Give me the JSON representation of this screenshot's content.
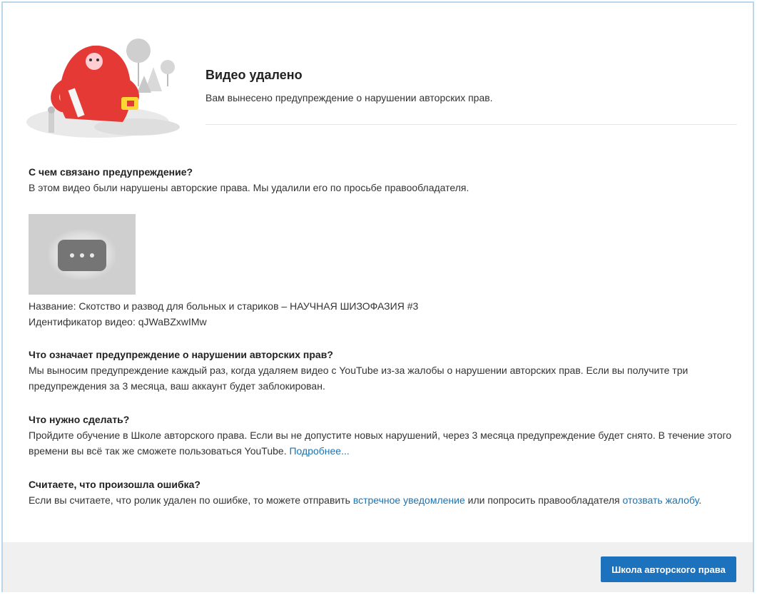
{
  "header": {
    "title": "Видео удалено",
    "subtitle": "Вам вынесено предупреждение о нарушении авторских прав."
  },
  "reason": {
    "title": "С чем связано предупреждение?",
    "text": "В этом видео были нарушены авторские права. Мы удалили его по просьбе правообладателя."
  },
  "video": {
    "title_line": "Название: Скотство и развод для больных и стариков – НАУЧНАЯ ШИЗОФАЗИЯ #3",
    "id_line": "Идентификатор видео: qJWaBZxwIMw"
  },
  "meaning": {
    "title": "Что означает предупреждение о нарушении авторских прав?",
    "text": "Мы выносим предупреждение каждый раз, когда удаляем видео с YouTube из-за жалобы о нарушении авторских прав. Если вы получите три предупреждения за 3 месяца, ваш аккаунт будет заблокирован."
  },
  "todo": {
    "title": "Что нужно сделать?",
    "text": "Пройдите обучение в Школе авторского права. Если вы не допустите новых нарушений, через 3 месяца предупреждение будет снято. В течение этого времени вы всё так же сможете пользоваться YouTube.",
    "link": "Подробнее..."
  },
  "error": {
    "title": "Считаете, что произошла ошибка?",
    "text_before": "Если вы считаете, что ролик удален по ошибке, то можете отправить ",
    "link1": "встречное уведомление",
    "text_middle": " или попросить правообладателя ",
    "link2": "отозвать жалобу",
    "text_after": "."
  },
  "footer": {
    "button_label": "Школа авторского права"
  },
  "colors": {
    "accent": "#1c72bd",
    "link": "#1a73b3",
    "mascot": "#e53935"
  },
  "icons": {
    "thumbnail": "more-horiz-icon",
    "mascot": "yeti-mascot"
  }
}
